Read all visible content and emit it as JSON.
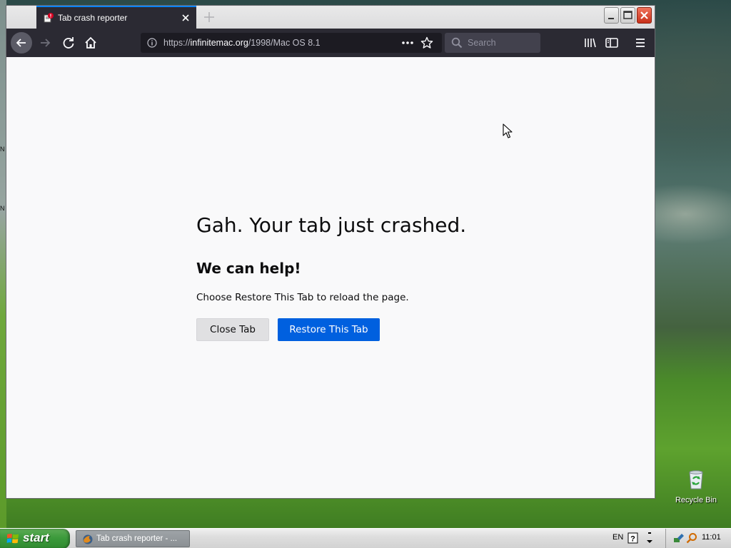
{
  "browser": {
    "tab_title": "Tab crash reporter",
    "url_prefix": "https://",
    "url_domain": "infinitemac.org",
    "url_path": "/1998/Mac OS 8.1",
    "search_placeholder": "Search"
  },
  "page": {
    "title": "Gah. Your tab just crashed.",
    "heading": "We can help!",
    "description": "Choose Restore This Tab to reload the page.",
    "close_button": "Close Tab",
    "restore_button": "Restore This Tab"
  },
  "desktop": {
    "recycle_bin_label": "Recycle Bin"
  },
  "taskbar": {
    "start_label": "start",
    "task_label": "Tab crash reporter - ...",
    "language": "EN",
    "clock": "11:01"
  },
  "colors": {
    "accent": "#0060df",
    "tab_indicator": "#0a84ff",
    "toolbar": "#2b2a33"
  }
}
